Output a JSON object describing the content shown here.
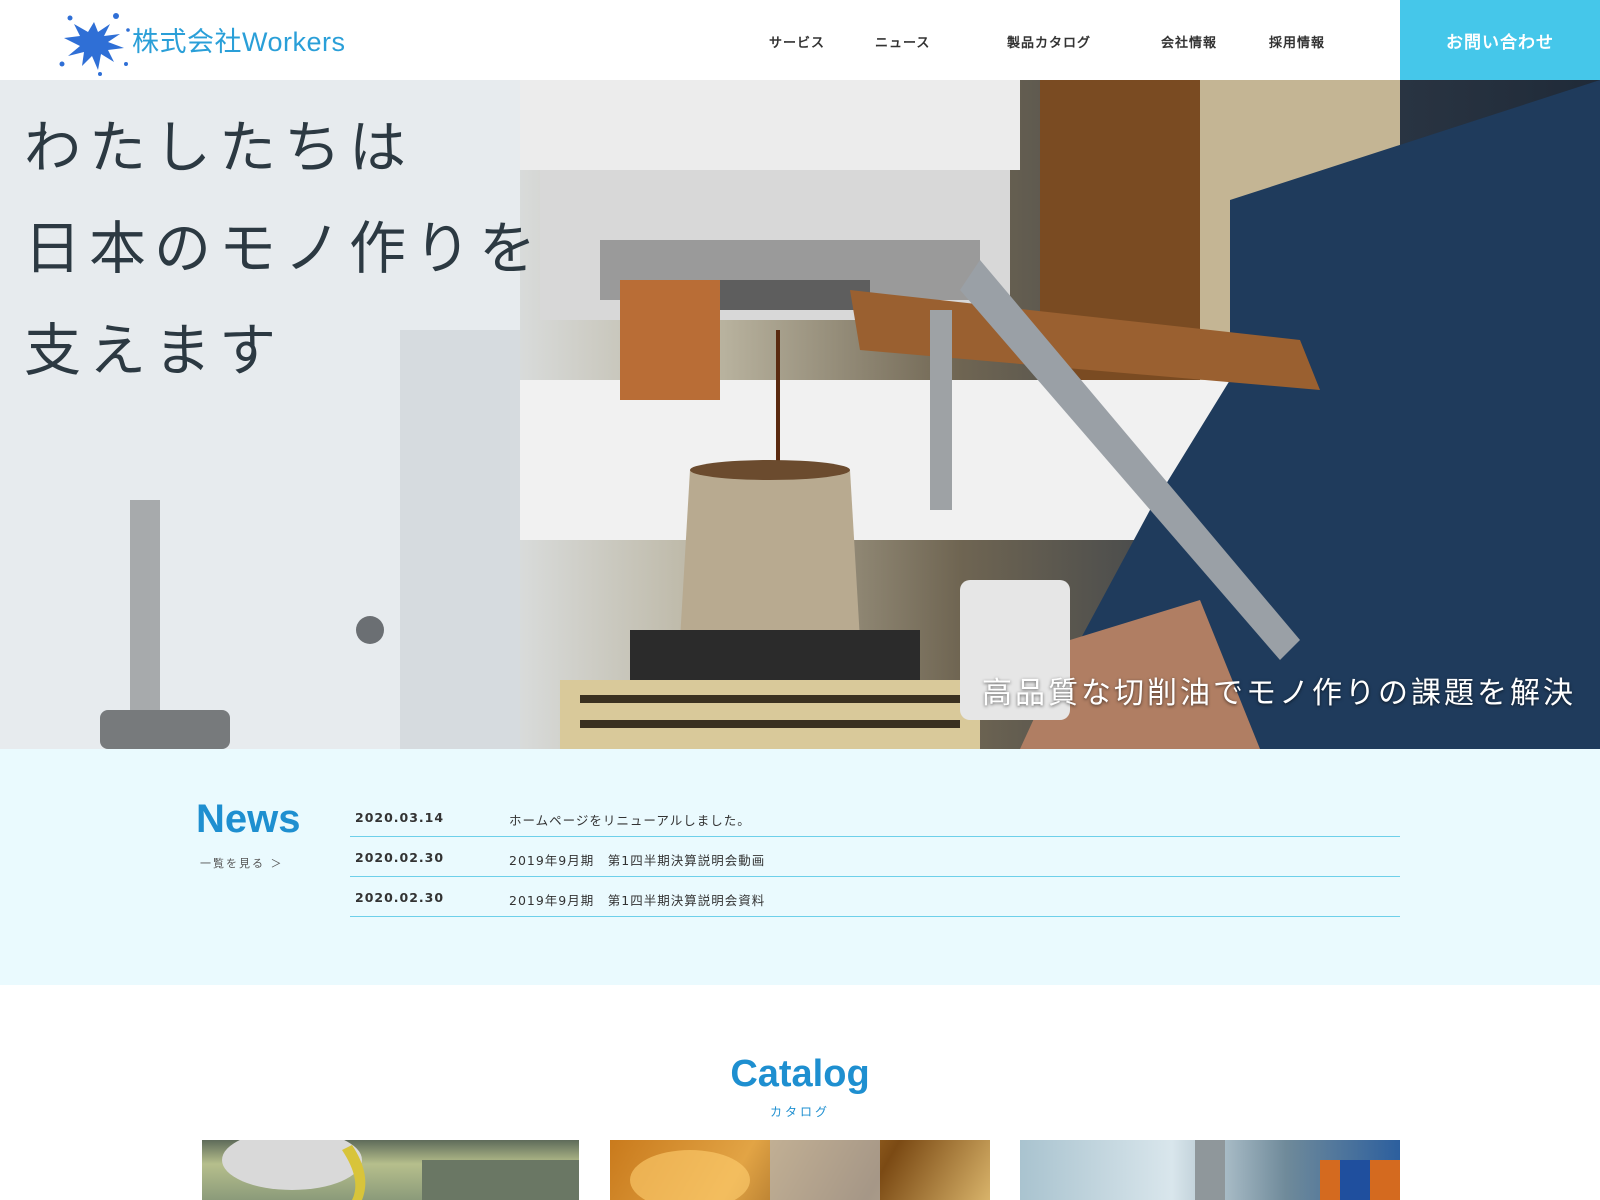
{
  "header": {
    "logo_text": "株式会社Workers",
    "nav": [
      "サービス",
      "ニュース",
      "製品カタログ",
      "会社情報",
      "採用情報"
    ],
    "contact_label": "お問い合わせ"
  },
  "hero": {
    "lines": [
      "わたしたちは",
      "日本のモノ作りを",
      "支えます"
    ],
    "subtitle": "高品質な切削油でモノ作りの課題を解決"
  },
  "news": {
    "title": "News",
    "more_label": "一覧を見る ＞",
    "items": [
      {
        "date": "2020.03.14",
        "text": "ホームページをリニューアルしました。"
      },
      {
        "date": "2020.02.30",
        "text": "2019年9月期　第1四半期決算説明会動画"
      },
      {
        "date": "2020.02.30",
        "text": "2019年9月期　第1四半期決算説明会資料"
      }
    ]
  },
  "catalog": {
    "title": "Catalog",
    "subtitle": "カタログ"
  },
  "colors": {
    "accent": "#45c7ea",
    "brand_blue": "#1e8fd0",
    "news_bg": "#eafafe"
  }
}
